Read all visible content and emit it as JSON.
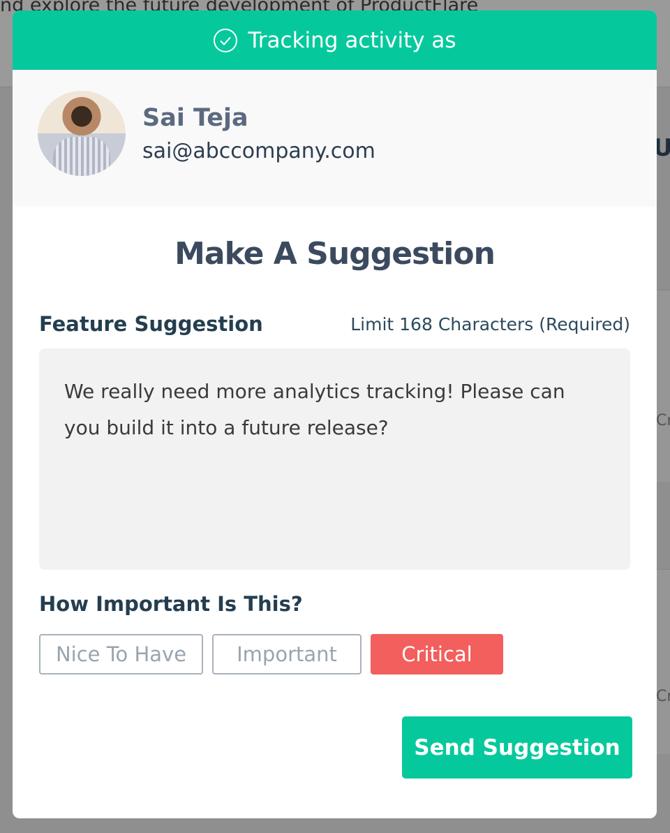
{
  "background": {
    "top_text": "nd explore the future development of ProductFlare",
    "side_heading": "Up",
    "side_fragments": [
      "Cr",
      "Cr"
    ]
  },
  "header": {
    "icon": "check-circle-icon",
    "text": "Tracking activity as"
  },
  "user": {
    "name": "Sai Teja",
    "email": "sai@abccompany.com"
  },
  "form": {
    "title": "Make A Suggestion",
    "feature_label": "Feature Suggestion",
    "limit_text": "Limit 168 Characters (Required)",
    "suggestion_value": "We really need more analytics tracking! Please can you build it into a future release?",
    "importance_label": "How Important Is This?",
    "importance_options": [
      {
        "label": "Nice To Have",
        "selected": false
      },
      {
        "label": "Important",
        "selected": false
      },
      {
        "label": "Critical",
        "selected": true
      }
    ],
    "submit_label": "Send Suggestion"
  },
  "colors": {
    "accent": "#05c99c",
    "critical": "#f25f5c"
  }
}
